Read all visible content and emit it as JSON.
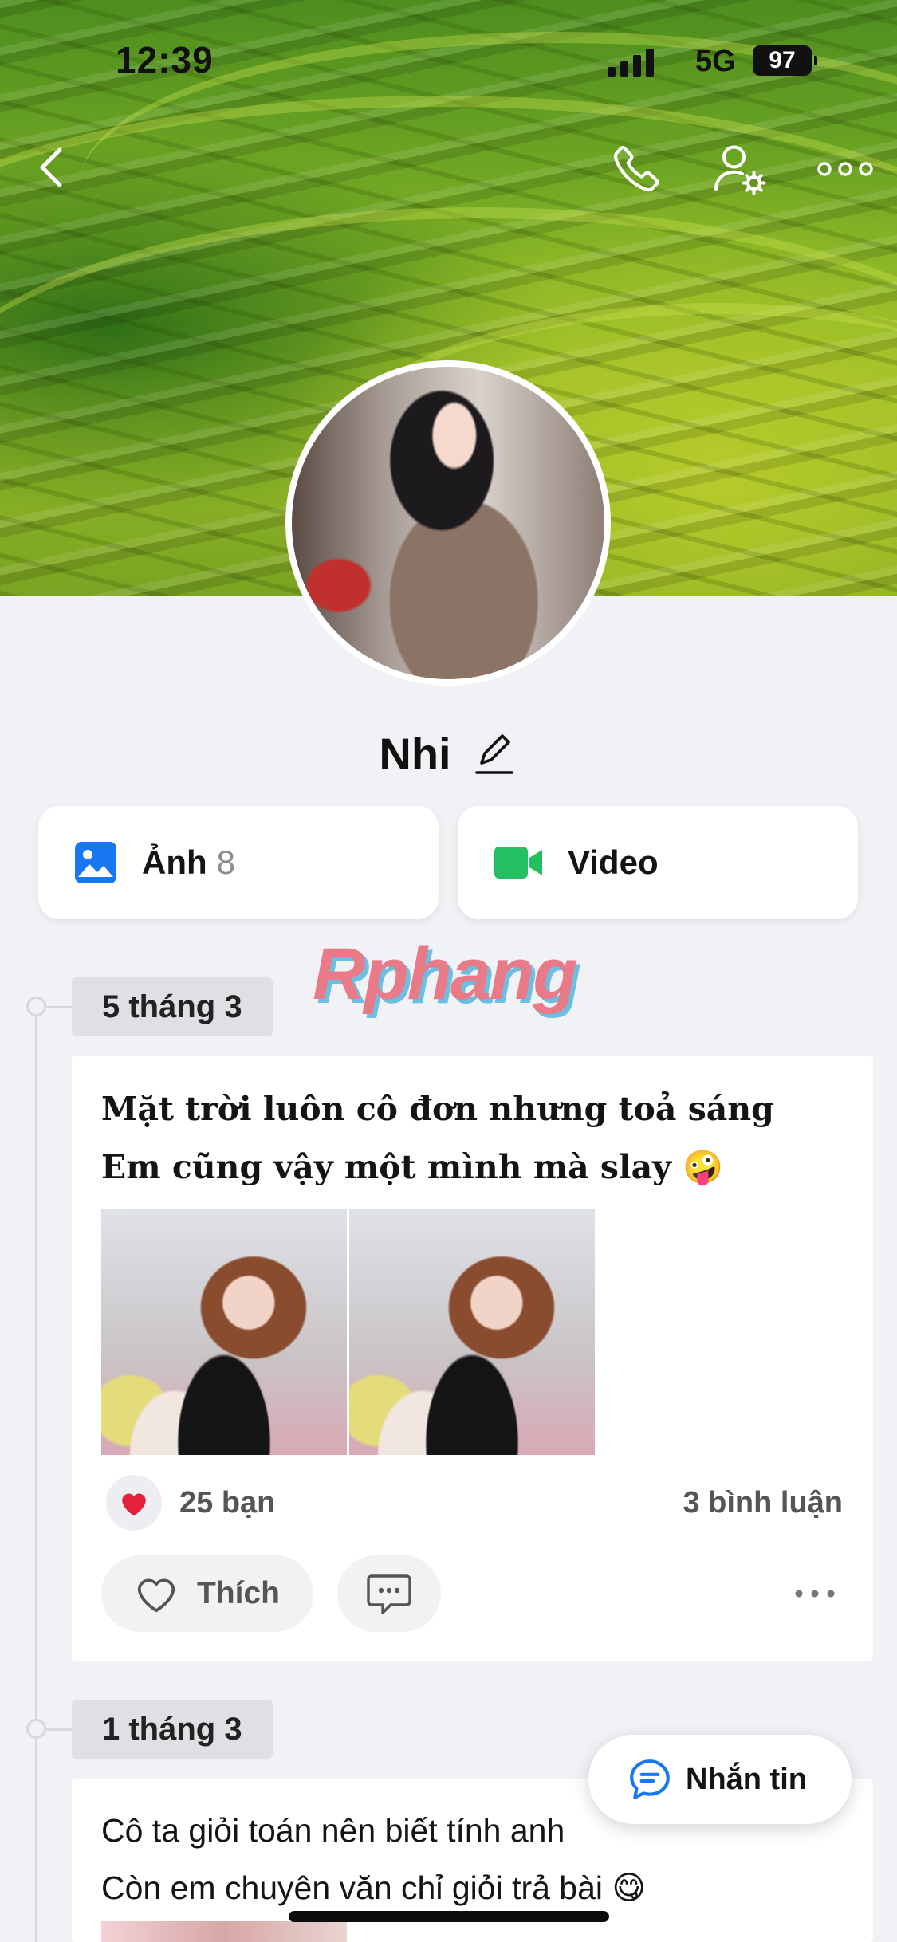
{
  "status_bar": {
    "time": "12:39",
    "network": "5G",
    "battery": "97"
  },
  "profile": {
    "name": "Nhi"
  },
  "media": {
    "photos_label": "Ảnh",
    "photos_count": "8",
    "videos_label": "Video"
  },
  "watermark": "Rphang",
  "timeline": [
    {
      "date": "5 tháng 3",
      "text_lines": [
        "Mặt trời luôn cô đơn nhưng toả sáng",
        "Em cũng vậy một mình mà slay 🤪"
      ],
      "likes": "25 bạn",
      "comments": "3 bình luận",
      "like_label": "Thích"
    },
    {
      "date": "1 tháng 3",
      "text_lines": [
        "Cô ta giỏi toán nên biết tính anh",
        "Còn em chuyên văn chỉ giỏi trả bài 😋"
      ]
    }
  ],
  "message_button": "Nhắn tin",
  "icons": {
    "back": "chevron-left-icon",
    "call": "phone-icon",
    "profile_settings": "user-gear-icon",
    "more": "more-horizontal-icon",
    "edit": "pencil-icon",
    "photos": "image-icon",
    "videos": "video-camera-icon",
    "heart": "heart-icon",
    "like": "heart-outline-icon",
    "comment": "comment-icon",
    "message": "chat-bubble-icon"
  },
  "colors": {
    "accent_blue": "#1877f2",
    "video_green": "#23c061",
    "heart_red": "#e2213b",
    "background": "#f1f2f5"
  }
}
